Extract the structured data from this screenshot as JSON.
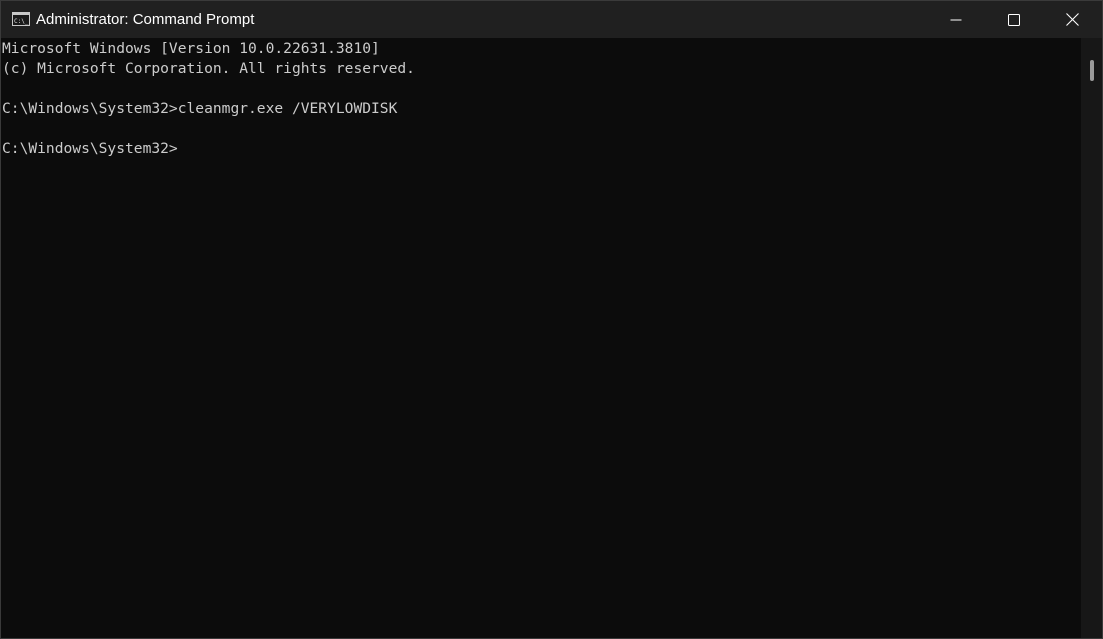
{
  "window": {
    "title": "Administrator: Command Prompt"
  },
  "icons": {
    "app": "command-prompt-icon",
    "minimize": "minimize-icon",
    "maximize": "maximize-icon",
    "close": "close-icon"
  },
  "console": {
    "lines": [
      "Microsoft Windows [Version 10.0.22631.3810]",
      "(c) Microsoft Corporation. All rights reserved.",
      "",
      "C:\\Windows\\System32>cleanmgr.exe /VERYLOWDISK",
      "",
      "C:\\Windows\\System32>"
    ]
  },
  "colors": {
    "background": "#0c0c0c",
    "titlebar": "#202020",
    "text": "#cccccc"
  }
}
